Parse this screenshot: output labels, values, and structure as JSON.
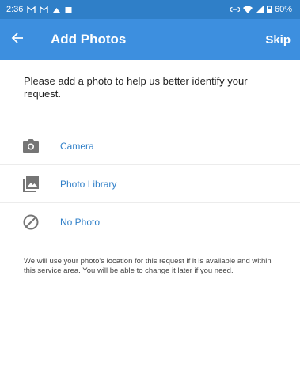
{
  "status_bar": {
    "time": "2:36",
    "battery": "60%",
    "icons": [
      "gmail-icon",
      "gmail-icon",
      "cloud-icon",
      "calendar-icon",
      "link-icon",
      "wifi-icon",
      "signal-icon",
      "battery-icon"
    ]
  },
  "header": {
    "back_icon": "arrow-left-icon",
    "title": "Add Photos",
    "skip_label": "Skip"
  },
  "intro_text": "Please add a photo to help us better identify your request.",
  "options": [
    {
      "label": "Camera",
      "icon": "camera-icon"
    },
    {
      "label": "Photo Library",
      "icon": "photo-library-icon"
    },
    {
      "label": "No Photo",
      "icon": "no-photo-icon"
    }
  ],
  "note_text": "We will use your photo's location for this request if it is available and within this service area.  You will be able to change it later if you need.",
  "colors": {
    "status_bar": "#2f7fc8",
    "app_bar": "#3d8fdf",
    "link": "#2f7fc8",
    "icon_gray": "#757575"
  }
}
